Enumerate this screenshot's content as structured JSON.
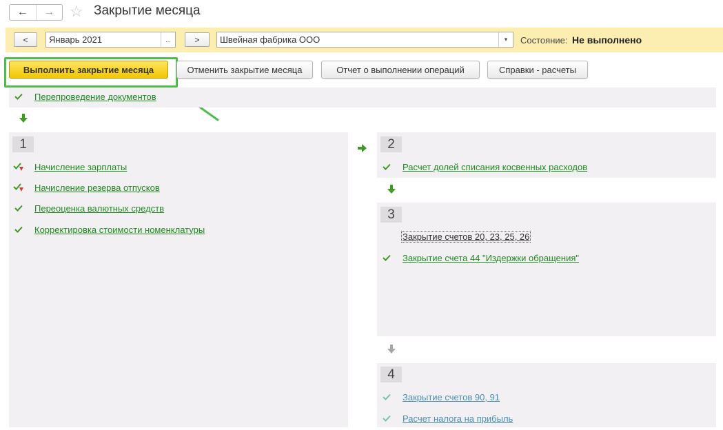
{
  "window": {
    "title": "Закрытие месяца",
    "back_icon": "←",
    "forward_icon": "→",
    "favorite_icon": "☆"
  },
  "params": {
    "prev_label": "<",
    "period_value": "Январь 2021",
    "period_select_label": "...",
    "next_label": ">",
    "organization_value": "Швейная фабрика ООО",
    "organization_dropdown": "▾",
    "state_label": "Состояние:",
    "state_value": "Не выполнено"
  },
  "toolbar": {
    "execute_label": "Выполнить закрытие месяца",
    "cancel_label": "Отменить закрытие месяца",
    "report_label": "Отчет о выполнении операций",
    "reference_label": "Справки - расчеты"
  },
  "pre_step": {
    "label": "Перепроведение документов"
  },
  "step1": {
    "number": "1",
    "items": [
      {
        "label": "Начисление зарплаты",
        "status": "done-warning"
      },
      {
        "label": "Начисление резерва отпусков",
        "status": "done-warning"
      },
      {
        "label": "Переоценка валютных средств",
        "status": "done"
      },
      {
        "label": "Корректировка стоимости номенклатуры",
        "status": "done"
      }
    ]
  },
  "step2": {
    "number": "2",
    "items": [
      {
        "label": "Расчет долей списания косвенных расходов",
        "status": "done"
      }
    ]
  },
  "step3": {
    "number": "3",
    "items": [
      {
        "label": "Закрытие счетов 20, 23, 25, 26",
        "status": "selected"
      },
      {
        "label": "Закрытие счета 44 \"Издержки обращения\"",
        "status": "done"
      }
    ]
  },
  "step4": {
    "number": "4",
    "items": [
      {
        "label": "Закрытие счетов 90, 91",
        "status": "pending"
      },
      {
        "label": "Расчет налога на прибыль",
        "status": "pending"
      }
    ]
  },
  "colors": {
    "accent_green": "#4ebc4a",
    "link_green": "#1e8a1e",
    "pending_blue": "#4a8fb0",
    "primary_button": "#f1c604",
    "params_panel": "#fbeeb0"
  }
}
